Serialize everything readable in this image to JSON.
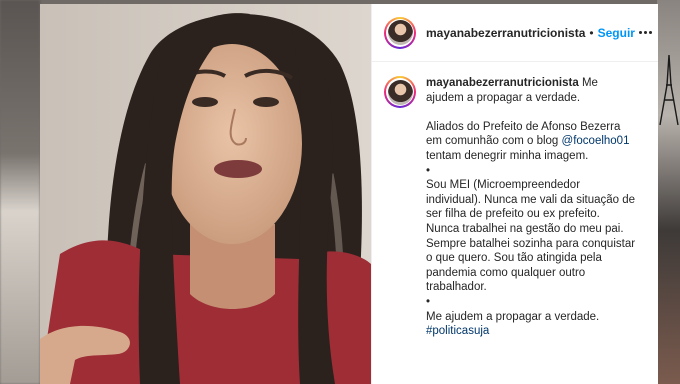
{
  "post": {
    "username": "mayanabezerranutricionista",
    "separator": "•",
    "follow_label": "Seguir",
    "more_icon": "more-options-icon"
  },
  "caption": {
    "username": "mayanabezerranutricionista",
    "first_text": "Me ajudem a propagar a verdade.",
    "para2_before": "Aliados do Prefeito de Afonso Bezerra em comunhão com o blog",
    "para2_mention": "@focoelho01",
    "para2_after": "tentam denegrir minha imagem.",
    "bullet1": "•",
    "para3": "Sou MEI (Microempreendedor individual). Nunca me vali da situação de ser filha de prefeito ou ex prefeito. Nunca trabalhei na gestão do meu pai. Sempre batalhei sozinha para conquistar o que quero. Sou tão atingida pela pandemia como qualquer outro trabalhador.",
    "bullet2": "•",
    "para4": "Me ajudem a propagar a verdade.",
    "hashtag": "#politicasuja"
  },
  "colors": {
    "follow": "#0095f6",
    "text": "#262626",
    "link": "#00376b"
  }
}
